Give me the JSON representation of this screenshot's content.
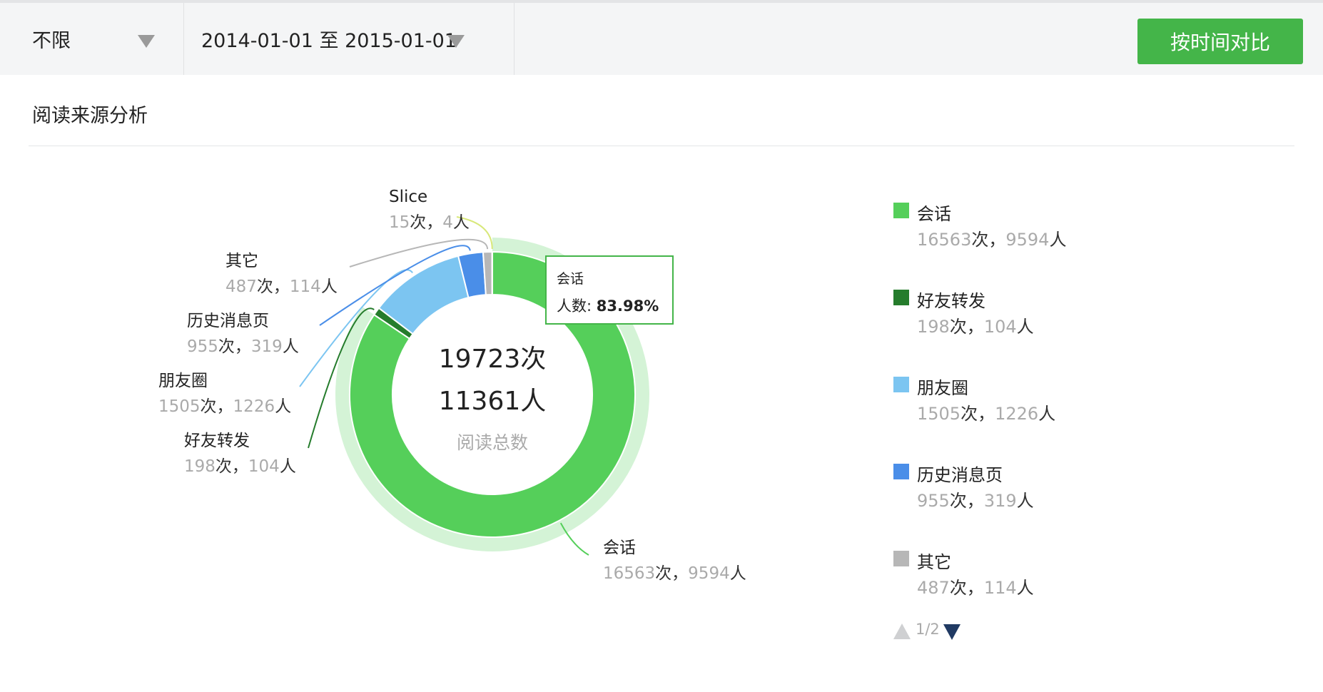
{
  "toolbar": {
    "filter_value": "不限",
    "date_range": "2014-01-01 至 2015-01-01",
    "compare_button": "按时间对比"
  },
  "section": {
    "title": "阅读来源分析"
  },
  "chart_data": {
    "type": "pie",
    "donut": true,
    "center": {
      "line1": "19723次",
      "line2": "11361人",
      "caption": "阅读总数"
    },
    "slices": [
      {
        "name": "会话",
        "reads": 16563,
        "readers": 9594,
        "color": "#55cf5a"
      },
      {
        "name": "好友转发",
        "reads": 198,
        "readers": 104,
        "color": "#257c2c"
      },
      {
        "name": "朋友圈",
        "reads": 1505,
        "readers": 1226,
        "color": "#7cc5f1"
      },
      {
        "name": "历史消息页",
        "reads": 955,
        "readers": 319,
        "color": "#4a8ee8"
      },
      {
        "name": "其它",
        "reads": 487,
        "readers": 114,
        "color": "#b7b7b7"
      },
      {
        "name": "Slice",
        "reads": 15,
        "readers": 4,
        "color": "#d8e87a"
      }
    ],
    "units": {
      "reads": "次",
      "readers": "人",
      "separator": "，"
    },
    "highlighted": {
      "name": "会话",
      "metric_label": "人数",
      "percent": "83.98%"
    },
    "legend": {
      "position": "right",
      "page": "1/2"
    }
  }
}
